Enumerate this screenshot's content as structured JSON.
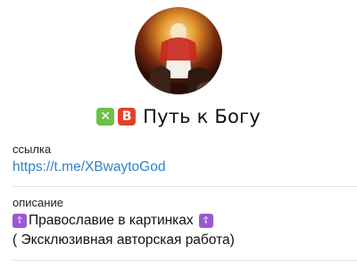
{
  "profile": {
    "avatar_icon": "religious-painting-avatar",
    "badge_x": "✕",
    "badge_v": "В",
    "badge_x_color": "#6cc04a",
    "badge_v_color": "#e2412c",
    "title": "Путь к Богу"
  },
  "link_section": {
    "label": "ссылка",
    "value": "https://t.me/XBwaytoGod",
    "color": "#2f84c8"
  },
  "description_section": {
    "label": "описание",
    "line1_text": "Православие в картинках",
    "line2_text": "( Эксклюзивная авторская работа)",
    "cross_glyph": "☦",
    "cross_color": "#9b59d0"
  }
}
